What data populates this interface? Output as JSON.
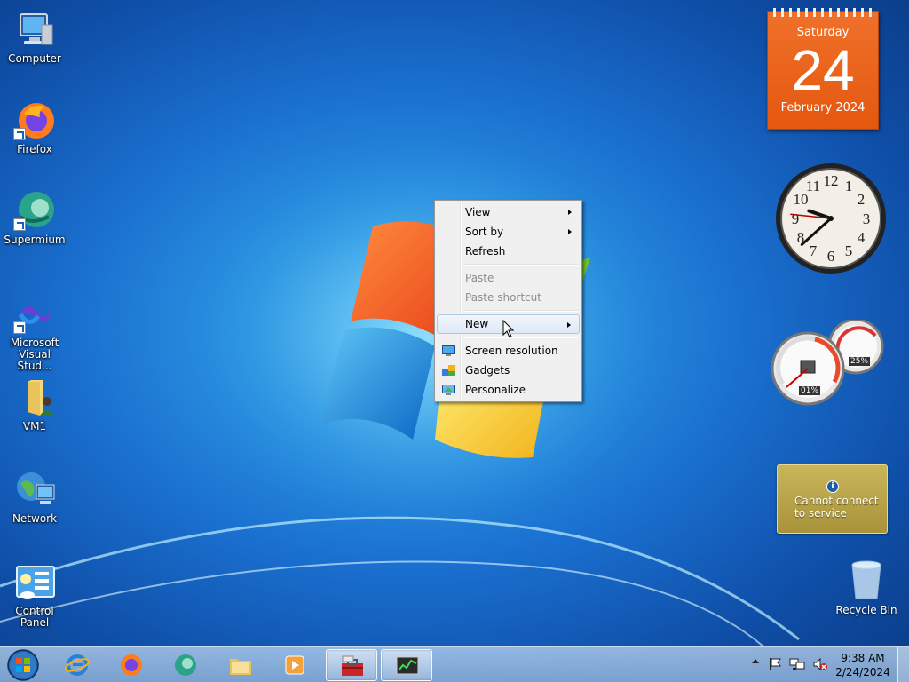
{
  "desktop": {
    "icons": [
      {
        "label": "Computer"
      },
      {
        "label": "Firefox"
      },
      {
        "label": "Supermium"
      },
      {
        "label": "Microsoft Visual Stud..."
      },
      {
        "label": "VM1"
      },
      {
        "label": "Network"
      },
      {
        "label": "Control Panel"
      }
    ],
    "recycle_bin": {
      "label": "Recycle Bin"
    }
  },
  "gadgets": {
    "calendar": {
      "weekday": "Saturday",
      "day": "24",
      "month_year": "February 2024"
    },
    "clock": {
      "hour": 9,
      "minute": 38,
      "second": 46
    },
    "cpu_meter": {
      "cpu": "01%",
      "memory": "25%"
    },
    "weather": {
      "message": "Cannot connect to service"
    }
  },
  "context_menu": {
    "items": [
      {
        "label": "View",
        "submenu": true
      },
      {
        "label": "Sort by",
        "submenu": true
      },
      {
        "label": "Refresh"
      },
      {
        "label": "Paste",
        "disabled": true
      },
      {
        "label": "Paste shortcut",
        "disabled": true
      },
      {
        "label": "New",
        "submenu": true,
        "highlighted": true
      },
      {
        "label": "Screen resolution",
        "icon": "monitor-icon"
      },
      {
        "label": "Gadgets",
        "icon": "gadgets-icon"
      },
      {
        "label": "Personalize",
        "icon": "personalize-icon"
      }
    ]
  },
  "taskbar": {
    "pinned": [
      "internet-explorer",
      "firefox",
      "supermium",
      "file-explorer",
      "media-player",
      "toolbox",
      "task-manager"
    ],
    "time": "9:38 AM",
    "date": "2/24/2024"
  },
  "colors": {
    "calendar_orange": "#e8601a",
    "menu_bg": "#f0f0f0",
    "menu_highlight": "#dfe9f7"
  }
}
